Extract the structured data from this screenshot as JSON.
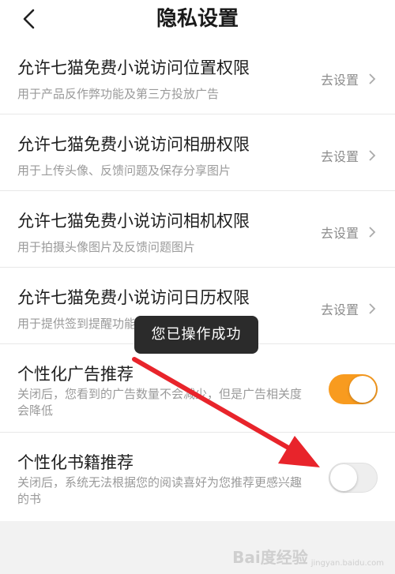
{
  "header": {
    "title": "隐私设置"
  },
  "permissions": [
    {
      "title": "允许七猫免费小说访问位置权限",
      "subtitle": "用于产品反作弊功能及第三方投放广告",
      "action": "去设置"
    },
    {
      "title": "允许七猫免费小说访问相册权限",
      "subtitle": "用于上传头像、反馈问题及保存分享图片",
      "action": "去设置"
    },
    {
      "title": "允许七猫免费小说访问相机权限",
      "subtitle": "用于拍摄头像图片及反馈问题图片",
      "action": "去设置"
    },
    {
      "title": "允许七猫免费小说访问日历权限",
      "subtitle": "用于提供签到提醒功能",
      "action": "去设置"
    }
  ],
  "toggles": [
    {
      "title": "个性化广告推荐",
      "subtitle": "关闭后，您看到的广告数量不会减少，但是广告相关度会降低",
      "state": "on"
    },
    {
      "title": "个性化书籍推荐",
      "subtitle": "关闭后，系统无法根据您的阅读喜好为您推荐更感兴趣的书",
      "state": "off"
    }
  ],
  "toast": "您已操作成功",
  "watermark": {
    "brand": "Bai度经验",
    "domain": "jingyan.baidu.com"
  },
  "colors": {
    "accent": "#f89b1f",
    "annotation_arrow": "#e8242b"
  }
}
